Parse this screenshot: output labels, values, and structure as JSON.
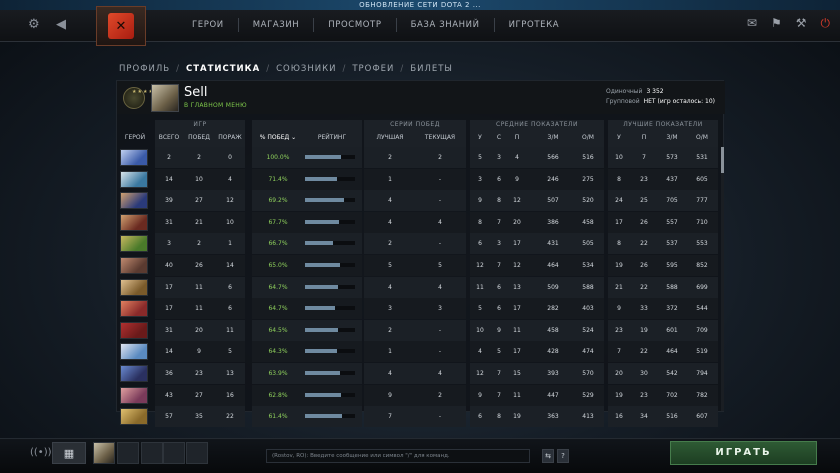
{
  "banner": "ОБНОВЛЕНИЕ СЕТИ DOTA 2 ...",
  "nav": [
    "ГЕРОИ",
    "МАГАЗИН",
    "ПРОСМОТР",
    "БАЗА ЗНАНИЙ",
    "ИГРОТЕКА"
  ],
  "tabs": {
    "items": [
      "ПРОФИЛЬ",
      "СТАТИСТИКА",
      "СОЮЗНИКИ",
      "ТРОФЕИ",
      "БИЛЕТЫ"
    ],
    "active": "СТАТИСТИКА"
  },
  "profile": {
    "name": "Sell",
    "status": "В ГЛАВНОМ МЕНЮ",
    "solo_label": "Одиночный",
    "solo_value": "3 352",
    "party_label": "Групповой",
    "party_value": "НЕТ (игр осталось: 10)",
    "rank_stars": "★★★★"
  },
  "table": {
    "groups": {
      "games": "ИГР",
      "streaks": "СЕРИИ ПОБЕД",
      "avg": "СРЕДНИЕ ПОКАЗАТЕЛИ",
      "best": "ЛУЧШИЕ ПОКАЗАТЕЛИ"
    },
    "columns": {
      "hero": "ГЕРОЙ",
      "total": "ВСЕГО",
      "wins": "ПОБЕД",
      "losses": "ПОРАЖ",
      "winpct": "% ПОБЕД",
      "rating": "РЕЙТИНГ",
      "best": "ЛУЧШАЯ",
      "current": "ТЕКУЩАЯ",
      "avg_k": "У",
      "avg_d": "С",
      "avg_a": "П",
      "avg_gpm": "З/М",
      "avg_xpm": "О/М",
      "best_k": "У",
      "best_a": "П",
      "best_gpm": "З/М",
      "best_xpm": "О/М"
    },
    "sort_icon": "chevron-down-icon",
    "rows": [
      {
        "total": "2",
        "wins": "2",
        "losses": "0",
        "winpct": "100.0%",
        "rating": 0.72,
        "best": "2",
        "current": "2",
        "ak": "5",
        "ad": "3",
        "aa": "4",
        "agpm": "566",
        "axpm": "516",
        "bk": "10",
        "ba": "7",
        "bgpm": "573",
        "bxpm": "531",
        "colors": [
          "#3a5aa8",
          "#c0d0f0"
        ]
      },
      {
        "total": "14",
        "wins": "10",
        "losses": "4",
        "winpct": "71.4%",
        "rating": 0.64,
        "best": "1",
        "current": "-",
        "ak": "3",
        "ad": "6",
        "aa": "9",
        "agpm": "246",
        "axpm": "275",
        "bk": "8",
        "ba": "23",
        "bgpm": "437",
        "bxpm": "605",
        "colors": [
          "#3a78a0",
          "#d8e4ea"
        ]
      },
      {
        "total": "39",
        "wins": "27",
        "losses": "12",
        "winpct": "69.2%",
        "rating": 0.78,
        "best": "4",
        "current": "-",
        "ak": "9",
        "ad": "8",
        "aa": "12",
        "agpm": "507",
        "axpm": "520",
        "bk": "24",
        "ba": "25",
        "bgpm": "705",
        "bxpm": "777",
        "colors": [
          "#2a3a7a",
          "#d0a070"
        ]
      },
      {
        "total": "31",
        "wins": "21",
        "losses": "10",
        "winpct": "67.7%",
        "rating": 0.68,
        "best": "4",
        "current": "4",
        "ak": "8",
        "ad": "7",
        "aa": "20",
        "agpm": "386",
        "axpm": "458",
        "bk": "17",
        "ba": "26",
        "bgpm": "557",
        "bxpm": "710",
        "colors": [
          "#6a2a20",
          "#d0a070"
        ]
      },
      {
        "total": "3",
        "wins": "2",
        "losses": "1",
        "winpct": "66.7%",
        "rating": 0.55,
        "best": "2",
        "current": "-",
        "ak": "6",
        "ad": "3",
        "aa": "17",
        "agpm": "431",
        "axpm": "505",
        "bk": "8",
        "ba": "22",
        "bgpm": "537",
        "bxpm": "553",
        "colors": [
          "#4a7a2a",
          "#c8b860"
        ]
      },
      {
        "total": "40",
        "wins": "26",
        "losses": "14",
        "winpct": "65.0%",
        "rating": 0.7,
        "best": "5",
        "current": "5",
        "ak": "12",
        "ad": "7",
        "aa": "12",
        "agpm": "464",
        "axpm": "534",
        "bk": "19",
        "ba": "26",
        "bgpm": "595",
        "bxpm": "852",
        "colors": [
          "#5a3a30",
          "#c08a70"
        ]
      },
      {
        "total": "17",
        "wins": "11",
        "losses": "6",
        "winpct": "64.7%",
        "rating": 0.66,
        "best": "4",
        "current": "4",
        "ak": "11",
        "ad": "6",
        "aa": "13",
        "agpm": "509",
        "axpm": "588",
        "bk": "21",
        "ba": "22",
        "bgpm": "588",
        "bxpm": "699",
        "colors": [
          "#7a5a2a",
          "#e0c090"
        ]
      },
      {
        "total": "17",
        "wins": "11",
        "losses": "6",
        "winpct": "64.7%",
        "rating": 0.6,
        "best": "3",
        "current": "3",
        "ak": "5",
        "ad": "6",
        "aa": "17",
        "agpm": "282",
        "axpm": "403",
        "bk": "9",
        "ba": "33",
        "bgpm": "372",
        "bxpm": "544",
        "colors": [
          "#8a2a2a",
          "#e08060"
        ]
      },
      {
        "total": "31",
        "wins": "20",
        "losses": "11",
        "winpct": "64.5%",
        "rating": 0.66,
        "best": "2",
        "current": "-",
        "ak": "10",
        "ad": "9",
        "aa": "11",
        "agpm": "458",
        "axpm": "524",
        "bk": "23",
        "ba": "19",
        "bgpm": "601",
        "bxpm": "709",
        "colors": [
          "#6a1a1a",
          "#b03030"
        ]
      },
      {
        "total": "14",
        "wins": "9",
        "losses": "5",
        "winpct": "64.3%",
        "rating": 0.63,
        "best": "1",
        "current": "-",
        "ak": "4",
        "ad": "5",
        "aa": "17",
        "agpm": "428",
        "axpm": "474",
        "bk": "7",
        "ba": "22",
        "bgpm": "464",
        "bxpm": "519",
        "colors": [
          "#5a8ac0",
          "#e0e4f0"
        ]
      },
      {
        "total": "36",
        "wins": "23",
        "losses": "13",
        "winpct": "63.9%",
        "rating": 0.7,
        "best": "4",
        "current": "4",
        "ak": "12",
        "ad": "7",
        "aa": "15",
        "agpm": "393",
        "axpm": "570",
        "bk": "20",
        "ba": "30",
        "bgpm": "542",
        "bxpm": "794",
        "colors": [
          "#2a3060",
          "#6a8ad0"
        ]
      },
      {
        "total": "43",
        "wins": "27",
        "losses": "16",
        "winpct": "62.8%",
        "rating": 0.72,
        "best": "9",
        "current": "2",
        "ak": "9",
        "ad": "7",
        "aa": "11",
        "agpm": "447",
        "axpm": "529",
        "bk": "19",
        "ba": "23",
        "bgpm": "702",
        "bxpm": "782",
        "colors": [
          "#7a3a5a",
          "#e0a0a0"
        ]
      },
      {
        "total": "57",
        "wins": "35",
        "losses": "22",
        "winpct": "61.4%",
        "rating": 0.74,
        "best": "7",
        "current": "-",
        "ak": "6",
        "ad": "8",
        "aa": "19",
        "agpm": "363",
        "axpm": "413",
        "bk": "16",
        "ba": "34",
        "bgpm": "516",
        "bxpm": "607",
        "colors": [
          "#8a6a2a",
          "#e0c070"
        ]
      }
    ]
  },
  "chat_placeholder": "(Rostov, RO): Введите сообщение или символ \"/\" для команд.",
  "chat_buttons": [
    "⇆",
    "?"
  ],
  "play_label": "ИГРАТЬ",
  "icons": {
    "settings": "gear-icon",
    "back": "back-icon",
    "mail": "mail-icon",
    "armory": "armory-icon",
    "power": "power-icon",
    "signal": "signal-icon",
    "party": "party-icon"
  }
}
